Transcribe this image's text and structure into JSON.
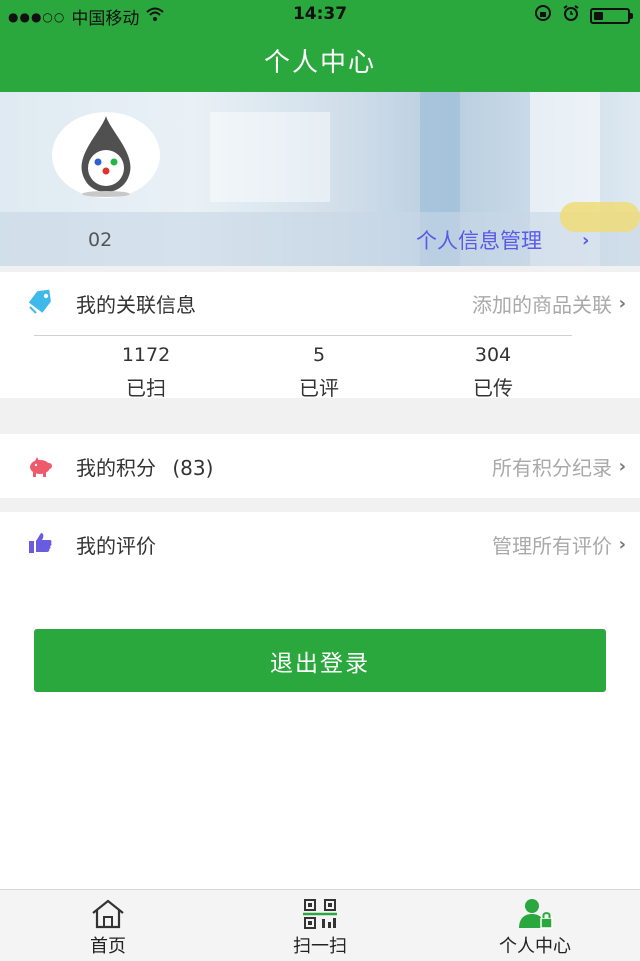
{
  "status_bar": {
    "carrier": "中国移动",
    "time": "14:37"
  },
  "nav": {
    "title": "个人中心"
  },
  "profile": {
    "user_id": "02",
    "info_link": "个人信息管理"
  },
  "linked_info": {
    "title": "我的关联信息",
    "link": "添加的商品关联",
    "stats": [
      {
        "value": "1172",
        "label": "已扫"
      },
      {
        "value": "5",
        "label": "已评"
      },
      {
        "value": "304",
        "label": "已传"
      }
    ]
  },
  "points": {
    "title": "我的积分",
    "count": "(83)",
    "link": "所有积分纪录"
  },
  "reviews": {
    "title": "我的评价",
    "link": "管理所有评价"
  },
  "logout_label": "退出登录",
  "tabbar": {
    "items": [
      {
        "label": "首页",
        "icon": "home-icon"
      },
      {
        "label": "扫一扫",
        "icon": "qr-scan-icon"
      },
      {
        "label": "个人中心",
        "icon": "user-icon"
      }
    ]
  },
  "colors": {
    "primary_green": "#2aa83e",
    "link_purple": "#5b59e8",
    "muted_gray": "#a9a9a9",
    "tag_blue": "#3fb8ea",
    "pig_red": "#ee5a6b",
    "thumb_purple": "#6a5ce0"
  }
}
